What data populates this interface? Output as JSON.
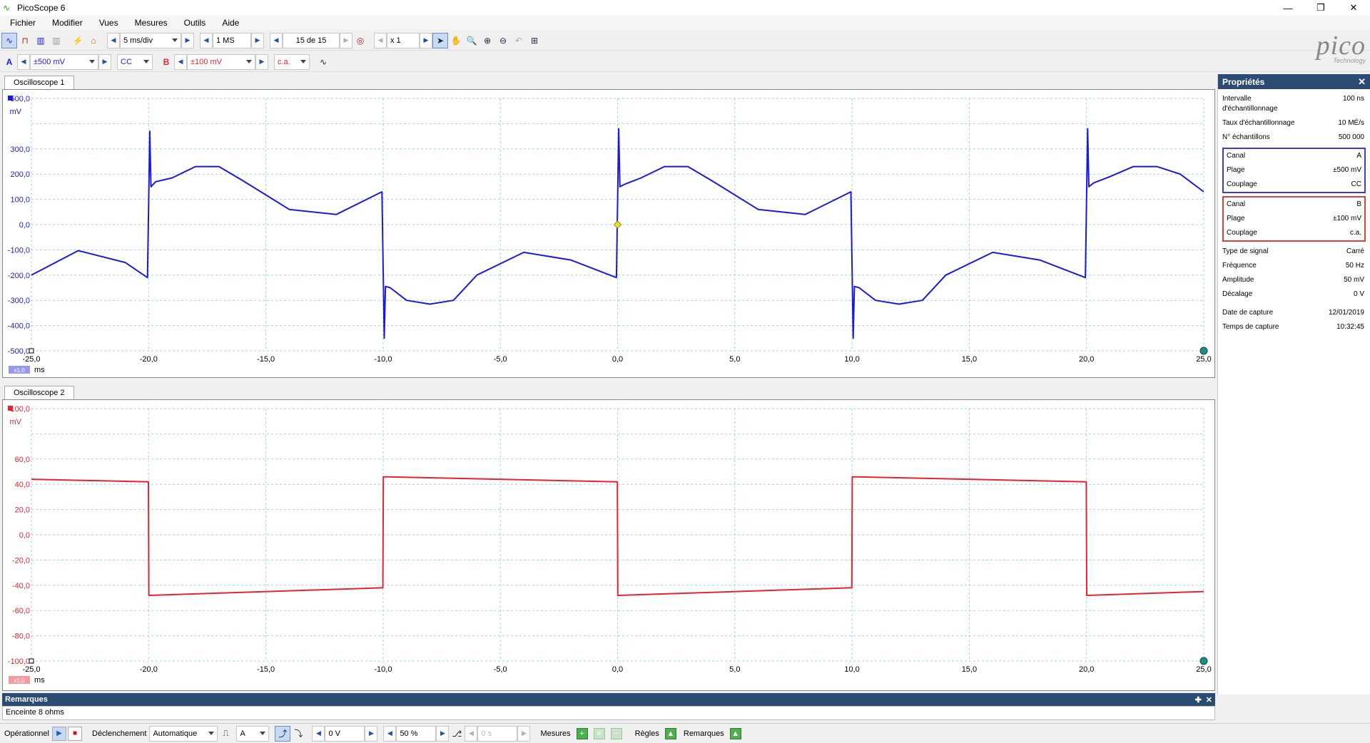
{
  "window": {
    "title": "PicoScope 6",
    "minimize": "—",
    "maximize": "❐",
    "close": "✕"
  },
  "menu": [
    "Fichier",
    "Modifier",
    "Vues",
    "Mesures",
    "Outils",
    "Aide"
  ],
  "toolbar1": {
    "timebase": "5 ms/div",
    "samples": "1 MS",
    "buffer": "15 de 15",
    "zoom": "x 1"
  },
  "toolbar2": {
    "chA_label": "A",
    "chA_range": "±500 mV",
    "chA_coupling": "CC",
    "chB_label": "B",
    "chB_range": "±100 mV",
    "chB_coupling": "c.a."
  },
  "logo": {
    "word": "pico",
    "sub": "Technology"
  },
  "scope1": {
    "tab": "Oscilloscope 1",
    "unit": "mV",
    "color": "#1a1adf",
    "y_ticks": [
      "500,0",
      "300,0",
      "200,0",
      "100,0",
      "0,0",
      "-100,0",
      "-200,0",
      "-300,0",
      "-400,0",
      "-500,0"
    ],
    "x_ticks": [
      "-25,0",
      "-20,0",
      "-15,0",
      "-10,0",
      "-5,0",
      "0,0",
      "5,0",
      "10,0",
      "15,0",
      "20,0",
      "25,0"
    ],
    "x_unit": "ms",
    "zoom_badge": "x1,0"
  },
  "scope2": {
    "tab": "Oscilloscope 2",
    "unit": "mV",
    "color": "#e8232f",
    "y_ticks": [
      "100,0",
      "60,0",
      "40,0",
      "20,0",
      "0,0",
      "-20,0",
      "-40,0",
      "-60,0",
      "-80,0",
      "-100,0"
    ],
    "x_ticks": [
      "-25,0",
      "-20,0",
      "-15,0",
      "-10,0",
      "-5,0",
      "0,0",
      "5,0",
      "10,0",
      "15,0",
      "20,0",
      "25,0"
    ],
    "x_unit": "ms",
    "zoom_badge": "x1,0"
  },
  "properties": {
    "title": "Propriétés",
    "close": "✕",
    "rows_top": [
      {
        "k": "Intervalle d'échantillonnage",
        "v": "100 ns"
      },
      {
        "k": "Taux d'échantillonnage",
        "v": "10 MÉ/s"
      },
      {
        "k": "N° échantillons",
        "v": "500 000"
      }
    ],
    "chA": [
      {
        "k": "Canal",
        "v": "A"
      },
      {
        "k": "Plage",
        "v": "±500 mV"
      },
      {
        "k": "Couplage",
        "v": "CC"
      }
    ],
    "chB": [
      {
        "k": "Canal",
        "v": "B"
      },
      {
        "k": "Plage",
        "v": "±100 mV"
      },
      {
        "k": "Couplage",
        "v": "c.a."
      }
    ],
    "signal": [
      {
        "k": "Type de signal",
        "v": "Carré"
      },
      {
        "k": "Fréquence",
        "v": "50 Hz"
      },
      {
        "k": "Amplitude",
        "v": "50 mV"
      },
      {
        "k": "Décalage",
        "v": "0 V"
      }
    ],
    "capture": [
      {
        "k": "Date de capture",
        "v": "12/01/2019"
      },
      {
        "k": "Temps de capture",
        "v": "10:32:45"
      }
    ]
  },
  "notes": {
    "title": "Remarques",
    "text": "Enceinte 8 ohms",
    "pin": "✚",
    "close": "✕"
  },
  "status": {
    "mode": "Opérationnel",
    "trigger_label": "Déclenchement",
    "trigger_mode": "Automatique",
    "trigger_channel": "A",
    "threshold": "0 V",
    "pretrigger": "50 %",
    "delay": "0 s",
    "measures": "Mesures",
    "rulers": "Règles",
    "notes": "Remarques"
  },
  "chart_data": [
    {
      "type": "line",
      "title": "Oscilloscope 1",
      "xlabel": "ms",
      "ylabel": "mV",
      "xlim": [
        -25,
        25
      ],
      "ylim": [
        -500,
        500
      ],
      "grid": true,
      "series": [
        {
          "name": "A",
          "x": [
            -25,
            -23,
            -21,
            -20.05,
            -19.95,
            -19.9,
            -19.7,
            -19,
            -18,
            -17,
            -16,
            -14,
            -12,
            -10.05,
            -9.95,
            -9.9,
            -9.7,
            -9,
            -8,
            -7,
            -6,
            -4,
            -2,
            -0.05,
            0.05,
            0.1,
            0.3,
            1,
            2,
            3,
            4,
            6,
            8,
            9.95,
            10.05,
            10.1,
            10.3,
            11,
            12,
            13,
            14,
            16,
            18,
            19.95,
            20.05,
            20.1,
            20.3,
            21,
            22,
            23,
            24,
            25
          ],
          "y": [
            -200,
            -103,
            -150,
            -210,
            370,
            150,
            170,
            185,
            230,
            230,
            175,
            60,
            40,
            130,
            -450,
            -245,
            -250,
            -300,
            -315,
            -300,
            -200,
            -110,
            -140,
            -210,
            380,
            150,
            160,
            185,
            230,
            230,
            175,
            60,
            40,
            130,
            -450,
            -245,
            -250,
            -300,
            -315,
            -300,
            -200,
            -110,
            -140,
            -210,
            380,
            150,
            165,
            190,
            230,
            230,
            200,
            130
          ]
        }
      ]
    },
    {
      "type": "line",
      "title": "Oscilloscope 2",
      "xlabel": "ms",
      "ylabel": "mV",
      "xlim": [
        -25,
        25
      ],
      "ylim": [
        -100,
        100
      ],
      "grid": true,
      "series": [
        {
          "name": "B",
          "x": [
            -25,
            -20.01,
            -19.99,
            -10.01,
            -9.99,
            -0.01,
            0.01,
            9.99,
            10.01,
            19.99,
            20.01,
            25
          ],
          "y": [
            44,
            42,
            -48,
            -42,
            46,
            42,
            -48,
            -42,
            46,
            42,
            -48,
            -45
          ]
        }
      ]
    }
  ]
}
